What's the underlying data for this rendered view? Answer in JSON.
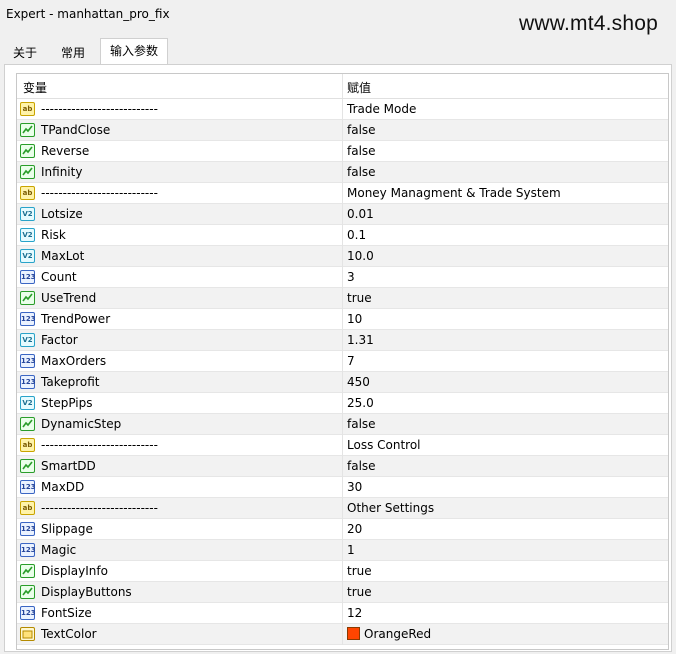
{
  "window": {
    "title": "Expert - manhattan_pro_fix"
  },
  "watermark": "www.mt4.shop",
  "tabs": [
    {
      "label": "关于"
    },
    {
      "label": "常用"
    },
    {
      "label": "输入参数",
      "active": true
    }
  ],
  "grid": {
    "headers": {
      "variable": "变量",
      "value": "赋值"
    },
    "rows": [
      {
        "name": "---------------------------",
        "value": "Trade Mode",
        "type": "string",
        "icon": "string-type-icon"
      },
      {
        "name": "TPandClose",
        "value": "false",
        "type": "bool",
        "icon": "boolean-type-icon"
      },
      {
        "name": "Reverse",
        "value": "false",
        "type": "bool",
        "icon": "boolean-type-icon"
      },
      {
        "name": "Infinity",
        "value": "false",
        "type": "bool",
        "icon": "boolean-type-icon"
      },
      {
        "name": "---------------------------",
        "value": "Money Managment & Trade System",
        "type": "string",
        "icon": "string-type-icon"
      },
      {
        "name": "Lotsize",
        "value": "0.01",
        "type": "double",
        "icon": "double-type-icon"
      },
      {
        "name": "Risk",
        "value": "0.1",
        "type": "double",
        "icon": "double-type-icon"
      },
      {
        "name": "MaxLot",
        "value": "10.0",
        "type": "double",
        "icon": "double-type-icon"
      },
      {
        "name": "Count",
        "value": "3",
        "type": "int",
        "icon": "integer-type-icon"
      },
      {
        "name": "UseTrend",
        "value": "true",
        "type": "bool",
        "icon": "boolean-type-icon"
      },
      {
        "name": "TrendPower",
        "value": "10",
        "type": "int",
        "icon": "integer-type-icon"
      },
      {
        "name": "Factor",
        "value": "1.31",
        "type": "double",
        "icon": "double-type-icon"
      },
      {
        "name": "MaxOrders",
        "value": "7",
        "type": "int",
        "icon": "integer-type-icon"
      },
      {
        "name": "Takeprofit",
        "value": "450",
        "type": "int",
        "icon": "integer-type-icon"
      },
      {
        "name": "StepPips",
        "value": "25.0",
        "type": "double",
        "icon": "double-type-icon"
      },
      {
        "name": "DynamicStep",
        "value": "false",
        "type": "bool",
        "icon": "boolean-type-icon"
      },
      {
        "name": "---------------------------",
        "value": "Loss Control",
        "type": "string",
        "icon": "string-type-icon"
      },
      {
        "name": "SmartDD",
        "value": "false",
        "type": "bool",
        "icon": "boolean-type-icon"
      },
      {
        "name": "MaxDD",
        "value": "30",
        "type": "int",
        "icon": "integer-type-icon"
      },
      {
        "name": "---------------------------",
        "value": "Other Settings",
        "type": "string",
        "icon": "string-type-icon"
      },
      {
        "name": "Slippage",
        "value": "20",
        "type": "int",
        "icon": "integer-type-icon"
      },
      {
        "name": "Magic",
        "value": "1",
        "type": "int",
        "icon": "integer-type-icon"
      },
      {
        "name": "DisplayInfo",
        "value": "true",
        "type": "bool",
        "icon": "boolean-type-icon"
      },
      {
        "name": "DisplayButtons",
        "value": "true",
        "type": "bool",
        "icon": "boolean-type-icon"
      },
      {
        "name": "FontSize",
        "value": "12",
        "type": "int",
        "icon": "integer-type-icon"
      },
      {
        "name": "TextColor",
        "value": "OrangeRed",
        "type": "color",
        "icon": "color-type-icon",
        "swatch": "#ff4500"
      }
    ]
  },
  "icon_glyphs": {
    "string": "ab",
    "double": "V2",
    "int": "123"
  },
  "colors": {
    "bool_chart": "#2a9d2a",
    "color_icon": "#b48a00"
  }
}
